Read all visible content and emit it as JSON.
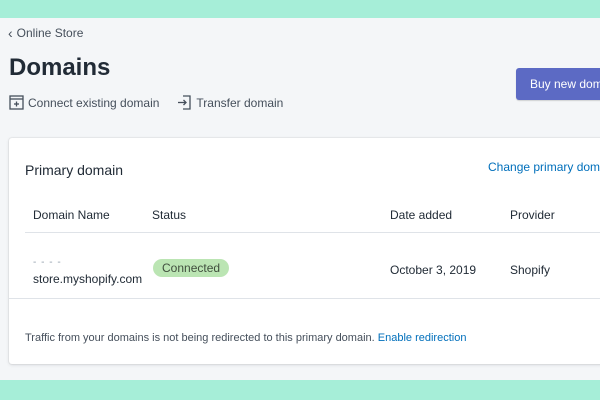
{
  "breadcrumb": {
    "label": "Online Store"
  },
  "page": {
    "title": "Domains"
  },
  "actions": {
    "connect_label": "Connect existing domain",
    "transfer_label": "Transfer domain"
  },
  "header": {
    "buy_button_label": "Buy new domain"
  },
  "card": {
    "title": "Primary domain",
    "change_link": "Change primary domain",
    "columns": [
      "Domain Name",
      "Status",
      "Date added",
      "Provider"
    ],
    "rows": [
      {
        "domain_masked": "- - - -",
        "domain": "store.myshopify.com",
        "status": "Connected",
        "date_added": "October 3, 2019",
        "provider": "Shopify"
      }
    ],
    "footer_text": "Traffic from your domains is not being redirected to this primary domain.",
    "footer_link": "Enable redirection"
  },
  "colors": {
    "accent": "#5c6ac4",
    "link": "#006fbb",
    "success_badge": "#bbe5b3",
    "frame": "#a6eed8"
  },
  "icons": [
    "chevron-left-icon",
    "connect-domain-icon",
    "transfer-domain-icon"
  ]
}
